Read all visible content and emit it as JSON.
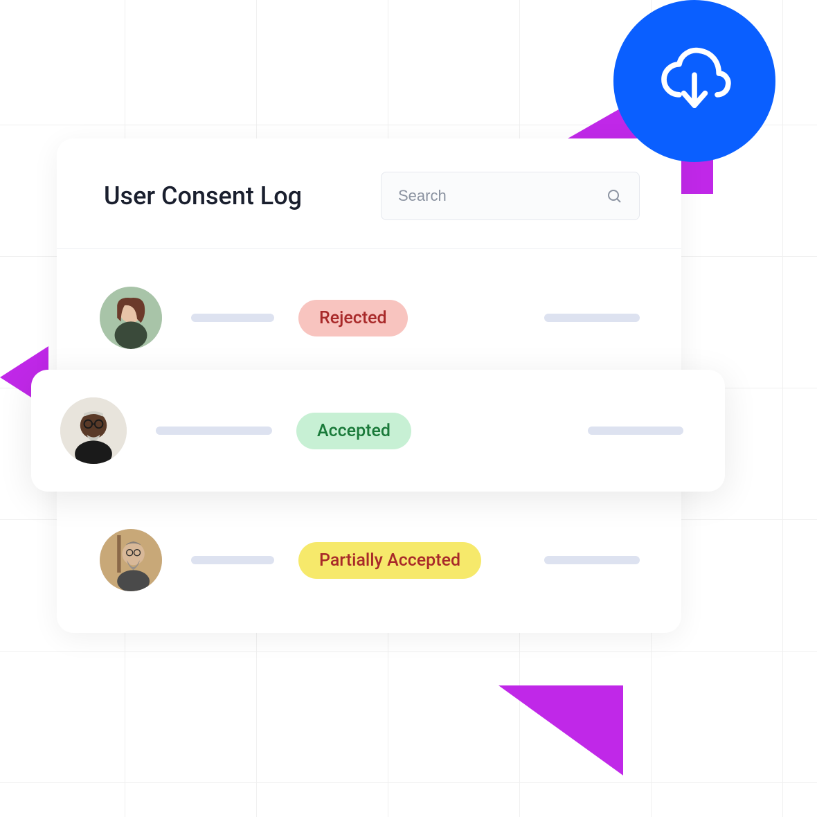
{
  "header": {
    "title": "User Consent Log",
    "search_placeholder": "Search"
  },
  "rows": [
    {
      "status": "Rejected",
      "status_type": "rejected"
    },
    {
      "status": "Accepted",
      "status_type": "accepted"
    },
    {
      "status": "Partially Accepted",
      "status_type": "partial"
    }
  ],
  "icons": {
    "download": "cloud-download-icon",
    "search": "search-icon"
  }
}
